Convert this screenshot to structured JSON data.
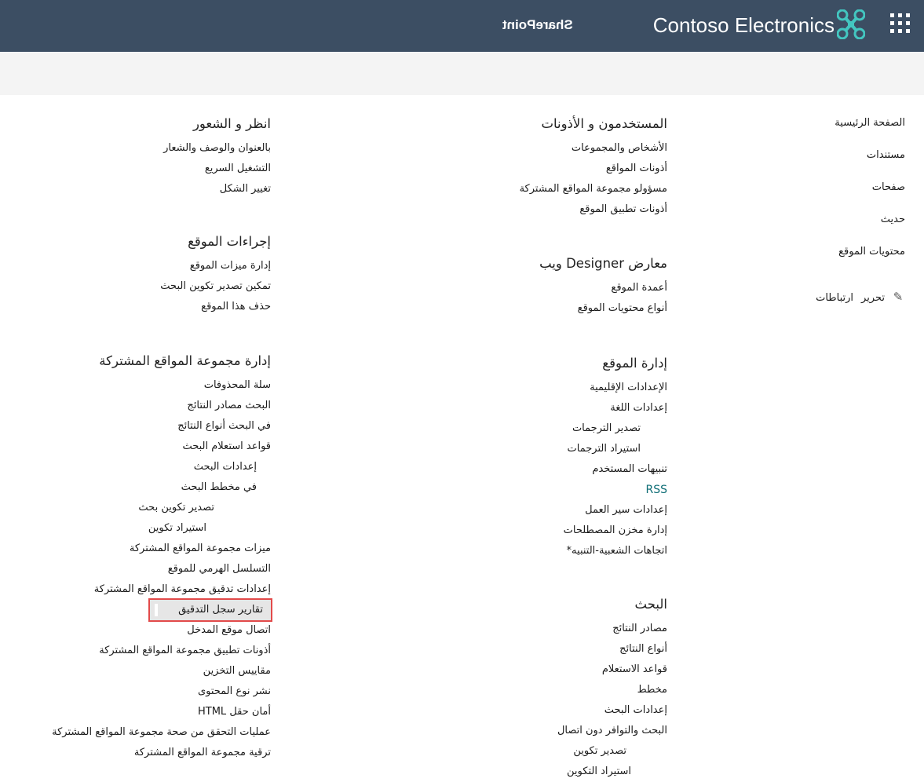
{
  "header": {
    "brand": "Contoso Electronics",
    "product": "SharePoint",
    "app_launcher_icon": "waffle-icon",
    "logo_icon": "drone-logo-icon",
    "bar_color": "#3c4e63"
  },
  "left_nav": {
    "items": [
      "الصفحة الرئيسية",
      "مستندات",
      "صفحات",
      "حديث",
      "محتويات الموقع"
    ],
    "edit_label": "تحرير",
    "links_label": "ارتباطات",
    "edit_icon": "pencil-icon"
  },
  "sections": {
    "users": {
      "title": "المستخدمون و الأذونات",
      "links": [
        "الأشخاص والمجموعات",
        "أذونات المواقع",
        "مسؤولو مجموعة المواقع المشتركة",
        "أذونات تطبيق الموقع"
      ]
    },
    "designer": {
      "title": "معارض Designer ويب",
      "links": [
        "أعمدة الموقع",
        "أنواع محتويات الموقع"
      ]
    },
    "site_admin": {
      "title": "إدارة الموقع",
      "links": [
        "الإعدادات الإقليمية",
        "إعدادات اللغة",
        "تصدير الترجمات",
        "استيراد الترجمات",
        "تنبيهات المستخدم",
        "RSS",
        "إعدادات سير العمل",
        "إدارة مخزن المصطلحات",
        "اتجاهات الشعبية-التنبيه*"
      ]
    },
    "search": {
      "title": "البحث",
      "links": [
        "مصادر النتائج",
        "أنواع النتائج",
        "قواعد الاستعلام",
        "مخطط",
        "إعدادات البحث",
        "البحث والتوافر دون اتصال",
        "تصدير تكوين",
        "استيراد التكوين"
      ]
    },
    "look": {
      "title": "انظر و الشعور",
      "links": [
        "بالعنوان والوصف والشعار",
        "التشغيل السريع",
        "تغيير الشكل"
      ]
    },
    "site_actions": {
      "title": "إجراءات الموقع",
      "links": [
        "إدارة ميزات الموقع",
        "تمكين تصدير تكوين البحث",
        "حذف هذا الموقع"
      ]
    },
    "collection_admin": {
      "title": "إدارة مجموعة المواقع المشتركة",
      "links": [
        "سلة المحذوفات",
        "البحث مصادر النتائج",
        "في البحث أنواع النتائج",
        "قواعد استعلام البحث",
        "إعدادات البحث",
        "في مخطط البحث",
        "تصدير تكوين بحث",
        "استيراد تكوين",
        "ميزات مجموعة المواقع المشتركة",
        "التسلسل الهرمي للموقع",
        "إعدادات تدقيق مجموعة المواقع المشتركة",
        "تقارير سجل التدقيق",
        "اتصال موقع المدخل",
        "أذونات تطبيق مجموعة المواقع المشتركة",
        "مقاييس التخزين",
        "نشر نوع المحتوى",
        "أمان حقل HTML",
        "عمليات التحقق من صحة مجموعة المواقع المشتركة",
        "ترقية مجموعة المواقع المشتركة"
      ]
    }
  },
  "highlight_color": "#e24a4a"
}
